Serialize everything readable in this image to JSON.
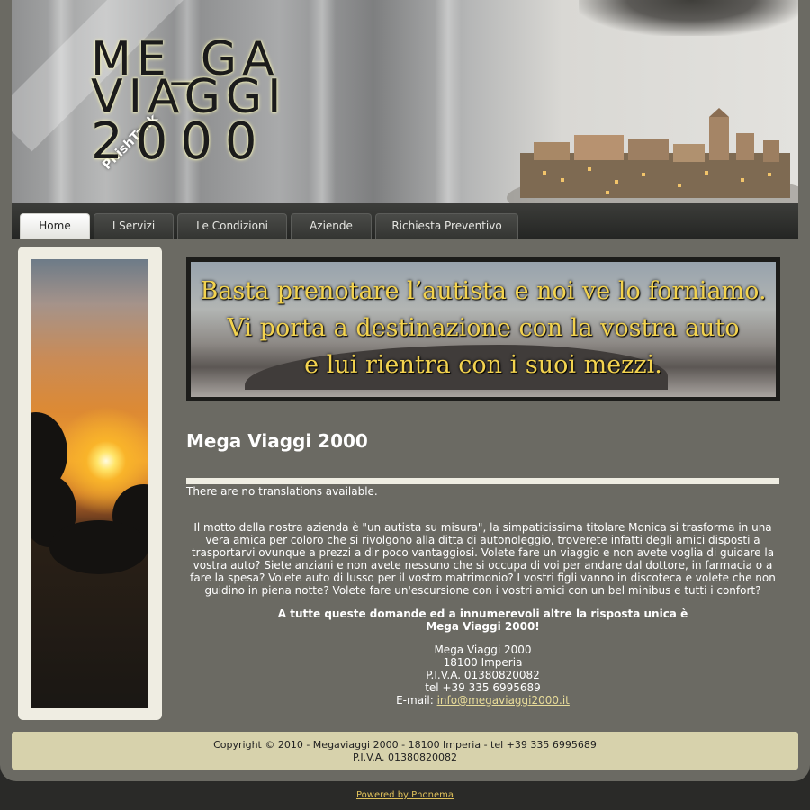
{
  "header": {
    "logo_line1": "ME_GA",
    "logo_line2": "VIAGGI",
    "logo_line3": "2000",
    "watermark": "PhishTank"
  },
  "nav": {
    "tabs": [
      {
        "label": "Home",
        "active": true
      },
      {
        "label": "I Servizi",
        "active": false
      },
      {
        "label": "Le Condizioni",
        "active": false
      },
      {
        "label": "Aziende",
        "active": false
      },
      {
        "label": "Richiesta Preventivo",
        "active": false
      }
    ]
  },
  "banner": {
    "line1": "Basta prenotare l’autista e noi ve lo forniamo.",
    "line2": "Vi porta a destinazione con la vostra auto",
    "line3": "e lui rientra con i suoi mezzi."
  },
  "main": {
    "title": "Mega Viaggi 2000",
    "no_translations": "There are no translations available.",
    "intro": "Il motto della nostra azienda è \"un autista su misura\", la simpaticissima titolare Monica si trasforma in una vera amica per coloro che si rivolgono alla ditta di autonoleggio, troverete infatti degli amici disposti a trasportarvi ovunque a prezzi a dir poco vantaggiosi. Volete fare un viaggio e non avete voglia di guidare la vostra auto? Siete anziani e non avete nessuno che si occupa di voi per andare dal dottore, in farmacia o a fare la spesa? Volete auto di lusso per il vostro matrimonio? I vostri figli vanno in discoteca e volete che non guidino in piena notte? Volete fare un'escursione con i vostri amici con un bel minibus e tutti i confort?",
    "tagline_line1": "A tutte queste domande ed a innumerevoli altre la risposta unica è",
    "tagline_line2": "Mega Viaggi 2000!",
    "contact": {
      "name": "Mega Viaggi 2000",
      "address": "18100 Imperia",
      "piva": "P.I.V.A. 01380820082",
      "tel": "tel +39 335 6995689",
      "email_label": "E-mail: ",
      "email": "info@megaviaggi2000.it"
    }
  },
  "footer": {
    "copyright": "Copyright © 2010 - Megaviaggi 2000 - 18100 Imperia - tel +39 335 6995689",
    "piva": "P.I.V.A. 01380820082",
    "powered": "Powered by Phonema"
  },
  "colors": {
    "frame": "#6b6a63",
    "accent_gold": "#f3d34f",
    "footer_bg": "#d7d2ac",
    "link": "#e8dc9a"
  }
}
